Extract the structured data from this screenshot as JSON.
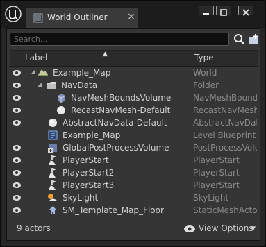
{
  "window": {
    "tab_title": "World Outliner",
    "tab_close": "×"
  },
  "search": {
    "placeholder": "Search..."
  },
  "header": {
    "label": "Label",
    "type": "Type",
    "sort": "▲"
  },
  "rows": [
    {
      "label": "Example_Map",
      "type": "World",
      "icon": "world-icon",
      "visible": true
    },
    {
      "label": "NavData",
      "type": "Folder",
      "icon": "folder-icon",
      "visible": true
    },
    {
      "label": "NavMeshBoundsVolume",
      "type": "NavMeshBoundsV",
      "icon": "volume-icon",
      "visible": true
    },
    {
      "label": "RecastNavMesh-Default",
      "type": "RecastNavMesh",
      "icon": "sphere-icon",
      "visible": true
    },
    {
      "label": "AbstractNavData-Default",
      "type": "AbstractNavData",
      "icon": "sphere-icon",
      "visible": true
    },
    {
      "label": "Example_Map",
      "type": "Level Blueprint",
      "icon": "blueprint-icon",
      "visible": false
    },
    {
      "label": "GlobalPostProcessVolume",
      "type": "PostProcessVolum",
      "icon": "postprocess-icon",
      "visible": true
    },
    {
      "label": "PlayerStart",
      "type": "PlayerStart",
      "icon": "playerstart-icon",
      "visible": true
    },
    {
      "label": "PlayerStart2",
      "type": "PlayerStart",
      "icon": "playerstart-icon",
      "visible": true
    },
    {
      "label": "PlayerStart3",
      "type": "PlayerStart",
      "icon": "playerstart-icon",
      "visible": true
    },
    {
      "label": "SkyLight",
      "type": "SkyLight",
      "icon": "skylight-icon",
      "visible": true
    },
    {
      "label": "SM_Template_Map_Floor",
      "type": "StaticMeshActor",
      "icon": "staticmesh-icon",
      "visible": true
    }
  ],
  "footer": {
    "count": "9 actors",
    "view_options": "View Options"
  }
}
